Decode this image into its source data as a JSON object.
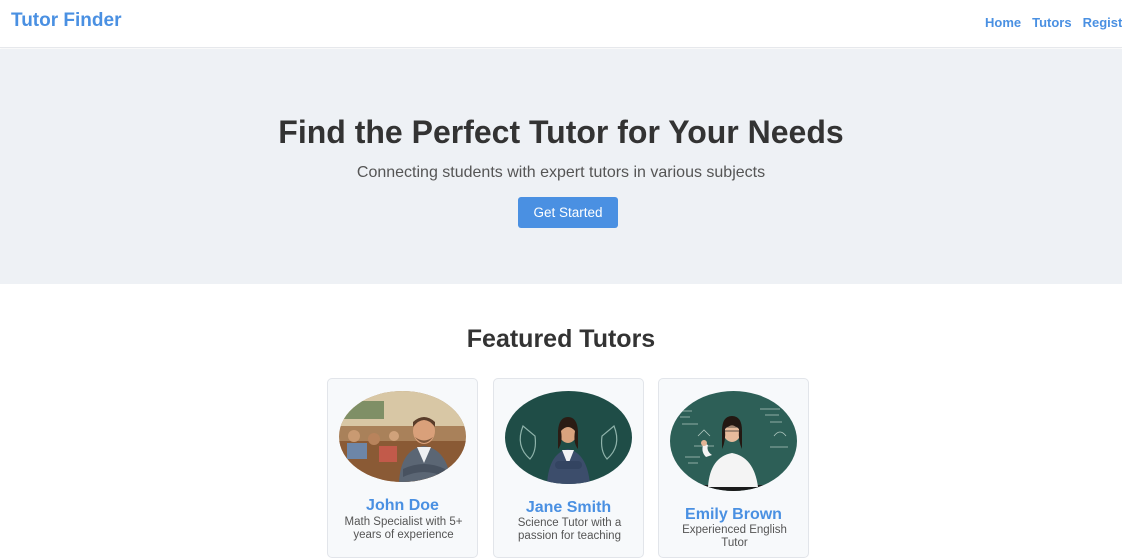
{
  "navbar": {
    "brand": "Tutor Finder",
    "links": [
      "Home",
      "Tutors",
      "Register"
    ]
  },
  "hero": {
    "title": "Find the Perfect Tutor for Your Needs",
    "subtitle": "Connecting students with expert tutors in various subjects",
    "cta_label": "Get Started"
  },
  "featured": {
    "title": "Featured Tutors",
    "tutors": [
      {
        "name": "John Doe",
        "description": "Math Specialist with 5+ years of experience"
      },
      {
        "name": "Jane Smith",
        "description": "Science Tutor with a passion for teaching"
      },
      {
        "name": "Emily Brown",
        "description": "Experienced English Tutor"
      }
    ]
  },
  "colors": {
    "accent": "#4a90e2",
    "hero_bg": "#eef1f5",
    "text": "#333333"
  }
}
